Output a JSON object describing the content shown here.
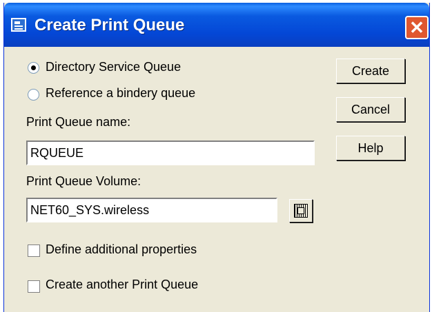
{
  "dialog": {
    "title": "Create Print Queue",
    "close_glyph": "✕"
  },
  "queue_type": {
    "option1_label": "Directory Service Queue",
    "option2_label": "Reference a bindery queue",
    "selected": "Directory Service Queue"
  },
  "name_field": {
    "label": "Print Queue name:",
    "value": "RQUEUE"
  },
  "volume_field": {
    "label": "Print Queue Volume:",
    "value": "NET60_SYS.wireless",
    "browse_icon": "browse-tree-icon"
  },
  "options": {
    "define_props_label": "Define additional properties",
    "define_props_checked": false,
    "another_queue_label": "Create another Print Queue",
    "another_queue_checked": false
  },
  "buttons": {
    "create": "Create",
    "cancel": "Cancel",
    "help": "Help"
  },
  "colors": {
    "titlebar": "#0A5AE0",
    "close": "#E0572F",
    "dialog_bg": "#ECE9D8"
  }
}
